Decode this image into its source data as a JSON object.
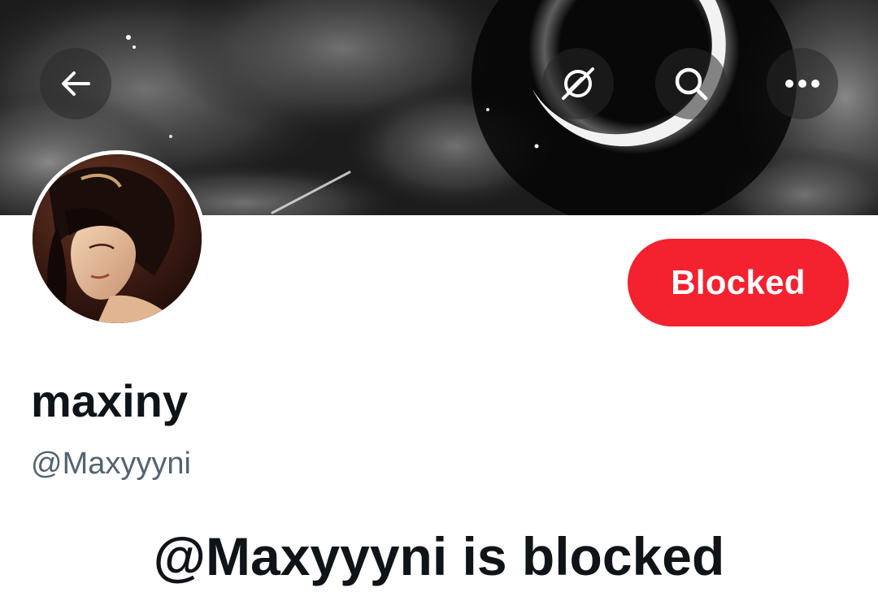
{
  "header": {
    "back_icon": "arrow-left-icon",
    "grok_icon": "grok-icon",
    "search_icon": "search-icon",
    "more_icon": "more-horizontal-icon"
  },
  "profile": {
    "display_name": "maxiny",
    "handle": "@Maxyyyni",
    "blocked_button_label": "Blocked",
    "blocked_message": "@Maxyyyni is blocked"
  },
  "colors": {
    "blocked_button": "#f4212e",
    "primary_text": "#0f1419",
    "secondary_text": "#536471"
  }
}
